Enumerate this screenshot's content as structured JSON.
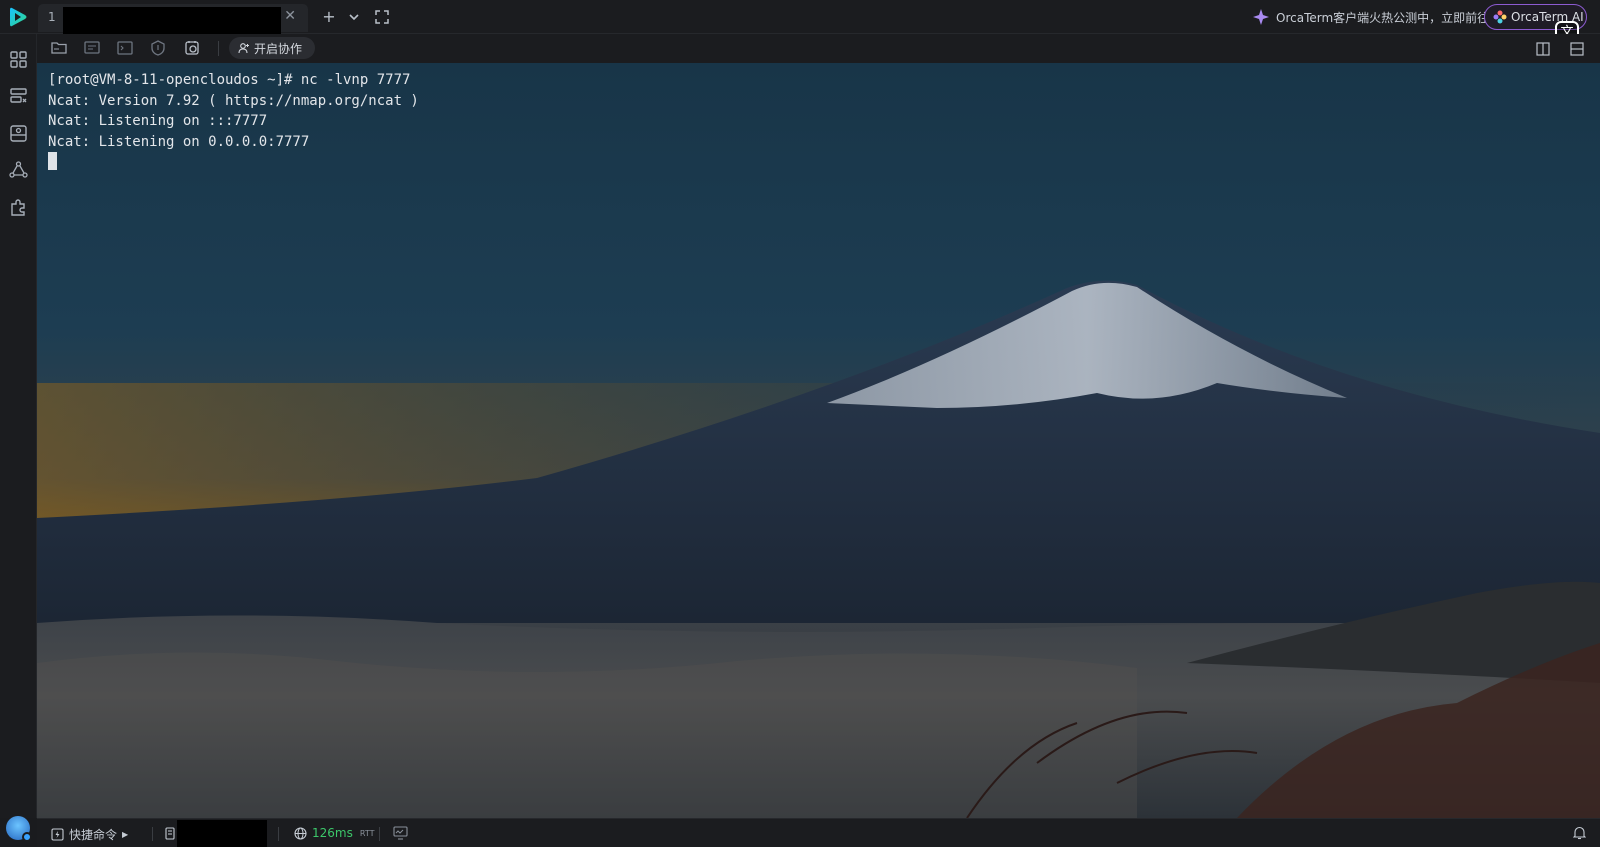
{
  "tabs": [
    {
      "index": "1",
      "title": ""
    }
  ],
  "header": {
    "promo_text": "OrcaTerm客户端火热公测中，立即前往",
    "ai_button_label": "OrcaTerm AI",
    "translate_badge": "文"
  },
  "toolbar": {
    "collab_label": "开启协作"
  },
  "terminal": {
    "lines": [
      "[root@VM-8-11-opencloudos ~]# nc -lvnp 7777",
      "Ncat: Version 7.92 ( https://nmap.org/ncat )",
      "Ncat: Listening on :::7777",
      "Ncat: Listening on 0.0.0.0:7777"
    ]
  },
  "statusbar": {
    "quick_commands_label": "快捷命令",
    "latency": "126ms",
    "latency_unit": "RTT"
  },
  "colors": {
    "accent_purple": "#8d5bd1",
    "latency_green": "#3cc76a"
  }
}
